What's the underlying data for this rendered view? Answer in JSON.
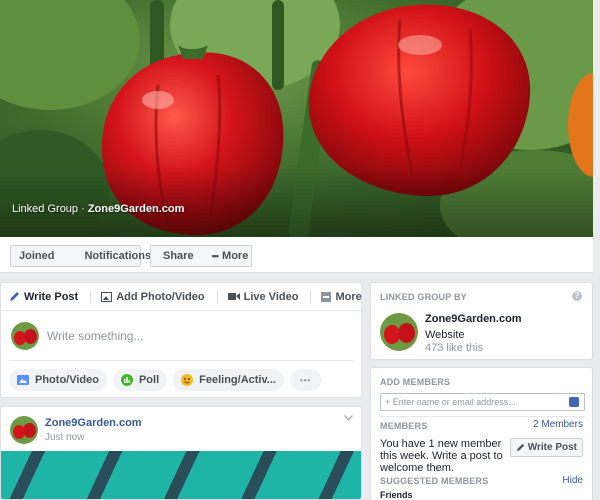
{
  "cover": {
    "prefix": "Linked Group · ",
    "group_name": "Zone9Garden.com"
  },
  "action_bar": {
    "joined": "Joined",
    "notifications": "Notifications",
    "share": "Share",
    "more": "More"
  },
  "composer": {
    "tabs": [
      "Write Post",
      "Add Photo/Video",
      "Live Video",
      "More"
    ],
    "placeholder": "Write something...",
    "actions": [
      "Photo/Video",
      "Poll",
      "Feeling/Activ..."
    ],
    "more_dots": "•••"
  },
  "post": {
    "author": "Zone9Garden.com",
    "time": "Just now"
  },
  "linked_group": {
    "header": "LINKED GROUP BY",
    "name": "Zone9Garden.com",
    "category": "Website",
    "likes": "473 like this",
    "help": "?"
  },
  "members": {
    "header": "ADD MEMBERS",
    "input_placeholder": "+ Enter name or email address...",
    "members_label": "MEMBERS",
    "count": "2 Members",
    "message": "You have 1 new member this week. Write a post to welcome them.",
    "write_post": "Write Post",
    "suggested_label": "SUGGESTED MEMBERS",
    "hide": "Hide",
    "friends": "Friends"
  },
  "colors": {
    "link": "#365899",
    "page_bg": "#e9ebee",
    "pepper_red": "#d4141b"
  }
}
